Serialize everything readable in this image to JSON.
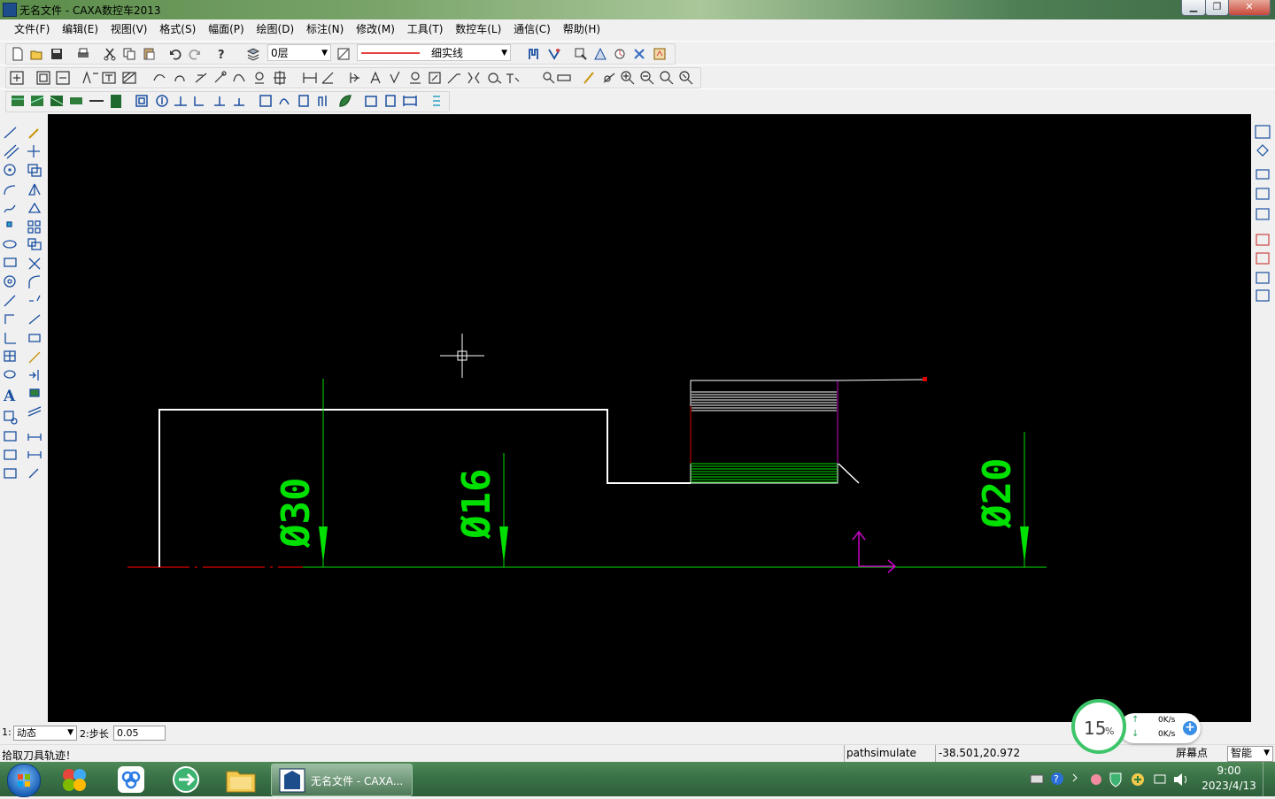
{
  "window": {
    "title": "无名文件 - CAXA数控车2013",
    "controls": [
      "minimize-icon",
      "maximize-icon",
      "close-icon"
    ]
  },
  "menu": [
    "文件(F)",
    "编辑(E)",
    "视图(V)",
    "格式(S)",
    "幅面(P)",
    "绘图(D)",
    "标注(N)",
    "修改(M)",
    "工具(T)",
    "数控车(L)",
    "通信(C)",
    "帮助(H)"
  ],
  "toolbar": {
    "layer_value": "0层",
    "linetype_value": "细实线"
  },
  "drawing": {
    "dimensions": [
      "Ø30",
      "Ø16",
      "Ø20"
    ],
    "colors": {
      "background": "#000000",
      "profile": "#ffffff",
      "dimension": "#00e000",
      "axis": "#e00000",
      "coordinate_marker": "#c800c8",
      "roughing_toolpath": "#00e000",
      "fill_lines": "#ffffff"
    }
  },
  "params": {
    "field1_label": "1:",
    "field1_value": "动态",
    "field2_label": "2:步长",
    "field2_value": "0.05"
  },
  "status": {
    "prompt": "拾取刀具轨迹！",
    "command": "pathsimulate",
    "coords": "-38.501,20.972",
    "snap_label": "屏幕点",
    "snap_mode": "智能"
  },
  "widget": {
    "cpu_percent": "15",
    "cpu_unit": "%",
    "up_speed": "0K/s",
    "down_speed": "0K/s"
  },
  "taskbar": {
    "active_window": "无名文件 - CAXA...",
    "clock_time": "9:00",
    "clock_date": "2023/4/13"
  }
}
